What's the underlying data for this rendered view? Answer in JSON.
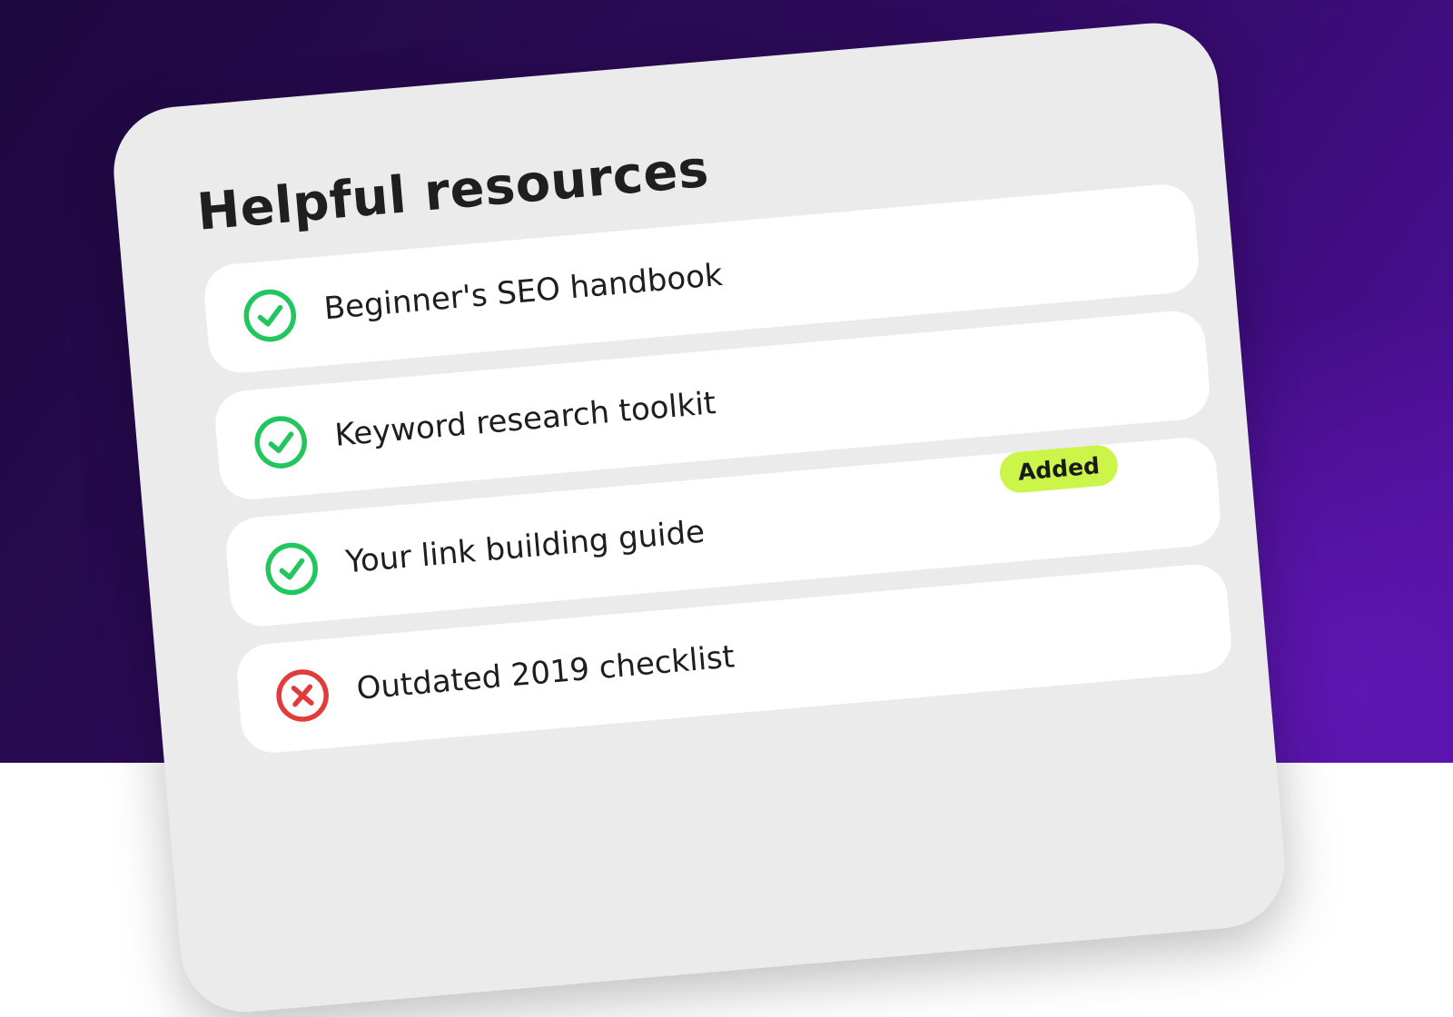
{
  "panel": {
    "title": "Helpful resources",
    "items": [
      {
        "label": "Beginner's SEO handbook",
        "status": "check-icon"
      },
      {
        "label": "Keyword research toolkit",
        "status": "check-icon"
      },
      {
        "label": "Your link building guide",
        "status": "check-icon",
        "badge": "Added"
      },
      {
        "label": "Outdated 2019 checklist",
        "status": "cross-icon"
      }
    ]
  },
  "colors": {
    "check": "#22c55e",
    "cross": "#e23b3b",
    "badge": "#ccf54a",
    "panel": "#ebebeb",
    "row": "#ffffff"
  }
}
